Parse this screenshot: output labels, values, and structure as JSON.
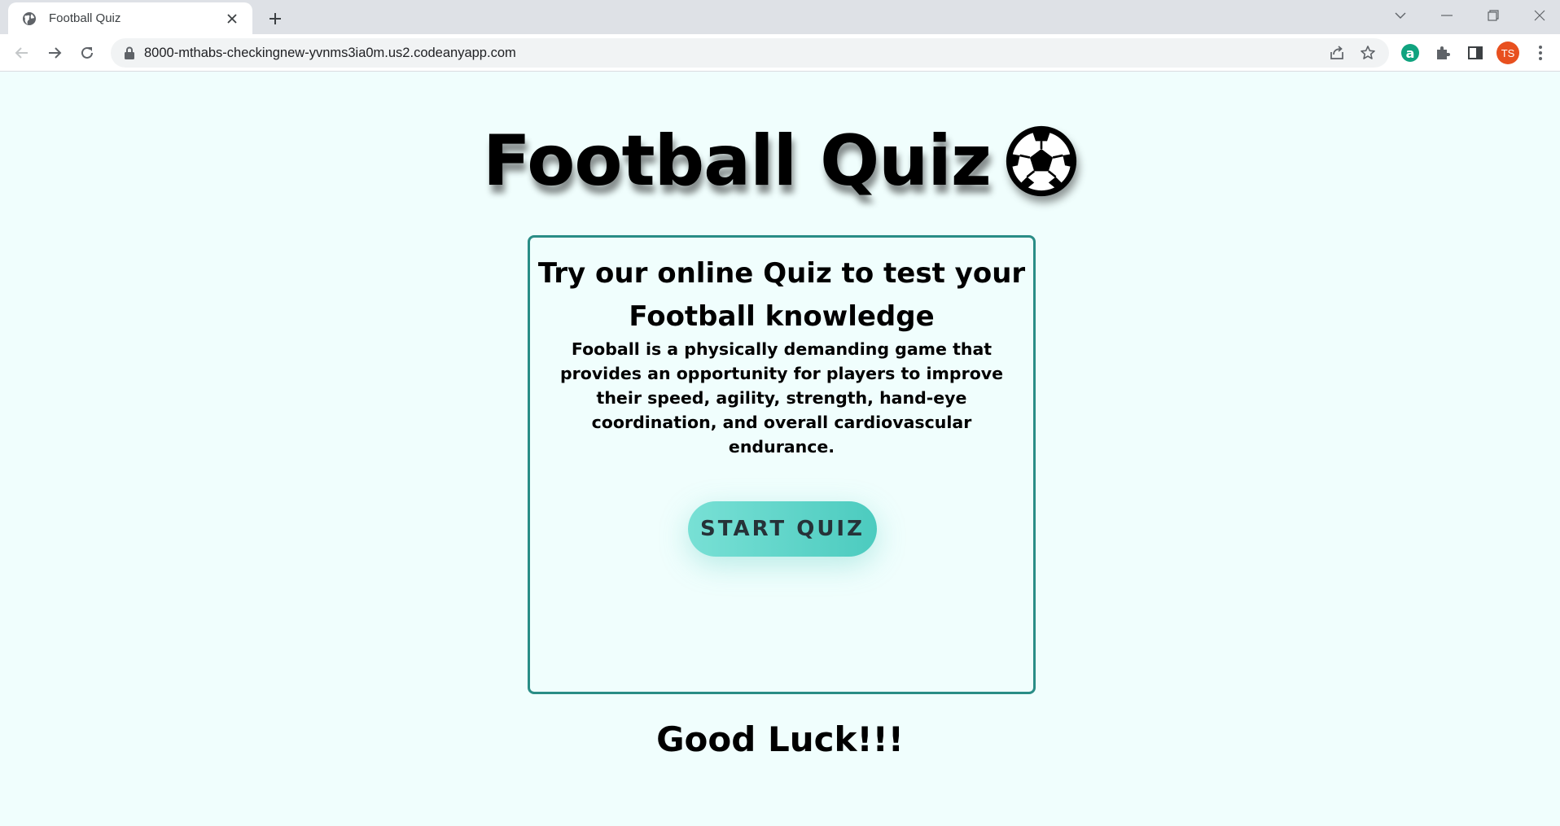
{
  "browser": {
    "tab_title": "Football Quiz",
    "url": "8000-mthabs-checkingnew-yvnms3ia0m.us2.codeanyapp.com",
    "avatar_initials": "TS",
    "avatar_color": "#e8501f",
    "extension_a_letter": "a",
    "icons": [
      "globe-icon",
      "close-icon",
      "plus-icon",
      "chevron-down-icon",
      "minimize-icon",
      "restore-icon",
      "window-close-icon",
      "back-arrow-icon",
      "forward-arrow-icon",
      "reload-icon",
      "lock-icon",
      "share-icon",
      "star-icon",
      "puzzle-icon",
      "sidepanel-icon",
      "more-vert-icon"
    ]
  },
  "page": {
    "title": "Football Quiz",
    "title_icon": "soccer-ball-icon",
    "card_heading": "Try our online Quiz to test your Football knowledge",
    "card_text": "Fooball is a physically demanding game that provides an opportunity for players to improve their speed, agility, strength, hand-eye coordination, and overall cardiovascular endurance.",
    "start_button": "START QUIZ",
    "footer_text": "Good Luck!!!"
  },
  "colors": {
    "page_background": "#f0fefd",
    "card_border": "#2a8d86",
    "button_gradient_start": "#78e0d5",
    "button_gradient_end": "#4ccbbf"
  }
}
